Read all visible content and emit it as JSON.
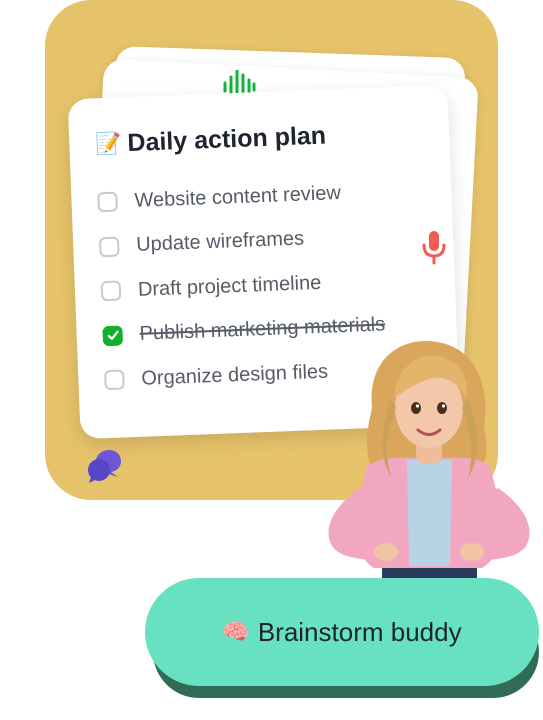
{
  "card": {
    "title_emoji": "📝",
    "title": "Daily action plan",
    "tasks": [
      {
        "label": "Website content review",
        "checked": false
      },
      {
        "label": "Update wireframes",
        "checked": false
      },
      {
        "label": "Draft project timeline",
        "checked": false
      },
      {
        "label": "Publish marketing materials",
        "checked": true
      },
      {
        "label": "Organize design files",
        "checked": false
      }
    ]
  },
  "icons": {
    "wave": "audio-waveform-icon",
    "mic": "microphone-icon",
    "chat": "chat-bubbles-icon",
    "check": "checkmark-icon"
  },
  "colors": {
    "panel": "#e6c36a",
    "accent_green": "#10b02a",
    "mic_red": "#ee5c52",
    "chat_purple": "#6b57d8",
    "button": "#68e0c2",
    "button_shadow": "#2f6b55"
  },
  "cta": {
    "emoji": "🧠",
    "label": "Brainstorm buddy"
  }
}
